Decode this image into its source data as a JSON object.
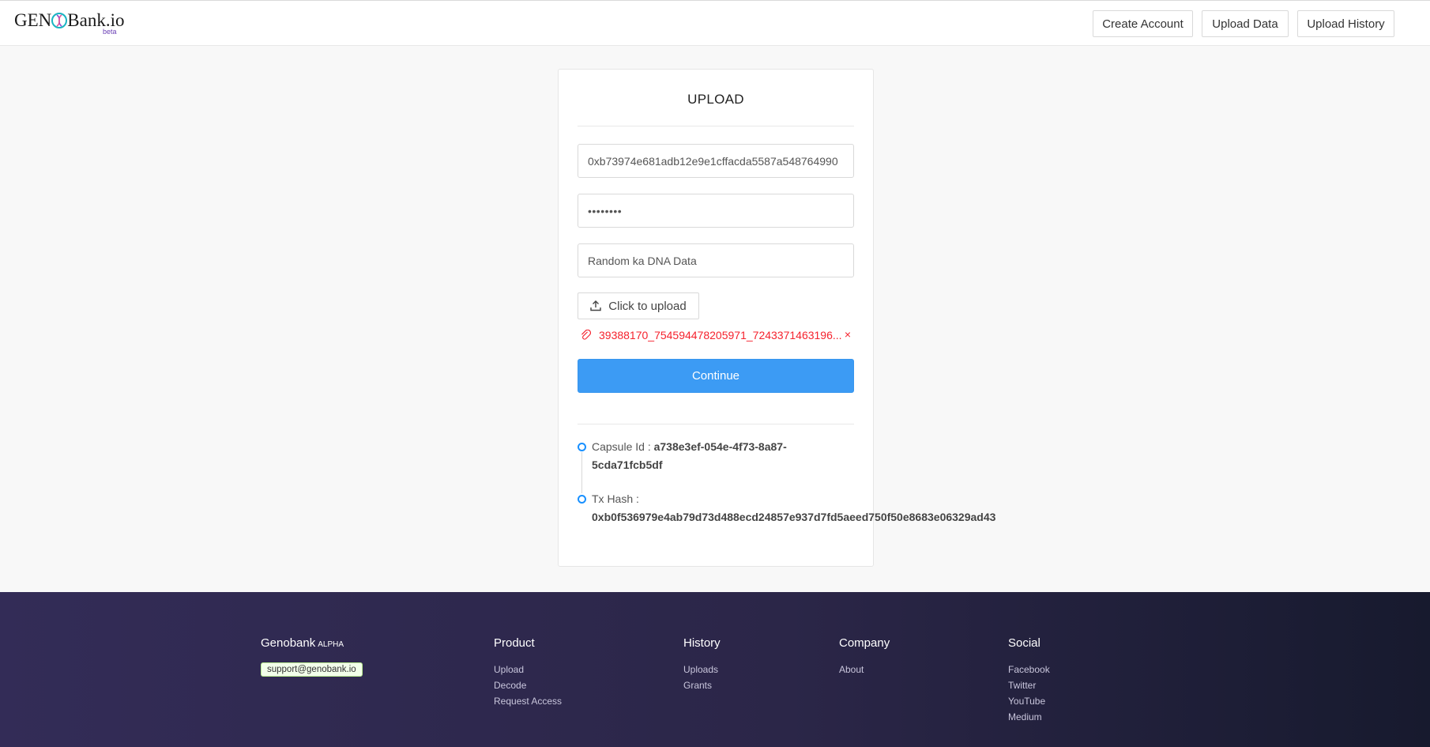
{
  "header": {
    "logo_text_left": "GEN",
    "logo_text_right": "Bank.io",
    "logo_badge": "beta",
    "nav": [
      "Create Account",
      "Upload Data",
      "Upload History"
    ]
  },
  "upload": {
    "title": "UPLOAD",
    "wallet_address": "0xb73974e681adb12e9e1cffacda5587a548764990",
    "password": "••••••••",
    "description": "Random ka DNA Data",
    "upload_button": "Click to upload",
    "file_name": "39388170_754594478205971_7243371463196...",
    "remove": "×",
    "continue_button": "Continue"
  },
  "result": {
    "capsule_label": "Capsule Id : ",
    "capsule_id_line1": "a738e3ef-054e-4f73-8a87-",
    "capsule_id_line2": "5cda71fcb5df",
    "tx_label": "Tx Hash :",
    "tx_hash": "0xb0f536979e4ab79d73d488ecd24857e937d7fd5aeed750f50e8683e06329ad43"
  },
  "footer": {
    "brand": "Genobank",
    "brand_tag": "ALPHA",
    "email": "support@genobank.io",
    "product": {
      "title": "Product",
      "links": [
        "Upload",
        "Decode",
        "Request Access"
      ]
    },
    "history": {
      "title": "History",
      "links": [
        "Uploads",
        "Grants"
      ]
    },
    "company": {
      "title": "Company",
      "links": [
        "About"
      ]
    },
    "social": {
      "title": "Social",
      "links": [
        "Facebook",
        "Twitter",
        "YouTube",
        "Medium"
      ]
    }
  },
  "colors": {
    "primary": "#3c9bf4",
    "error": "#f5222d",
    "footer_bg": "#2b2648"
  }
}
